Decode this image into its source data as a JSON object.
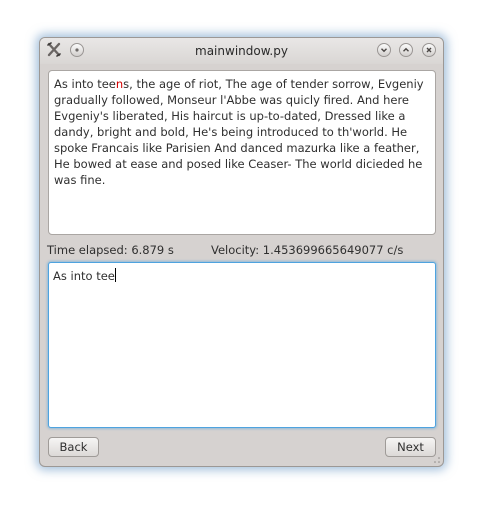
{
  "window": {
    "title": "mainwindow.py"
  },
  "passage": {
    "typed_correct": "As into tee",
    "typed_wrong": "n",
    "rest": "s, the age of riot, The age of tender sorrow, Evgeniy gradually followed, Monseur l'Abbe was quicly fired. And here Evgeniy's liberated, His haircut is up-to-dated, Dressed like a dandy, bright and bold, He's being introduced to th'world. He spoke Francais like Parisien And danced mazurka like a feather, He bowed at ease and posed like Ceaser- The world dicieded he was fine."
  },
  "status": {
    "time_elapsed": "Time elapsed: 6.879 s",
    "velocity": "Velocity: 1.453699665649077 c/s"
  },
  "input": {
    "value": "As into tee"
  },
  "buttons": {
    "back": "Back",
    "next": "Next"
  },
  "colors": {
    "error_highlight": "#d40000",
    "focus_border": "#4ea3df"
  }
}
